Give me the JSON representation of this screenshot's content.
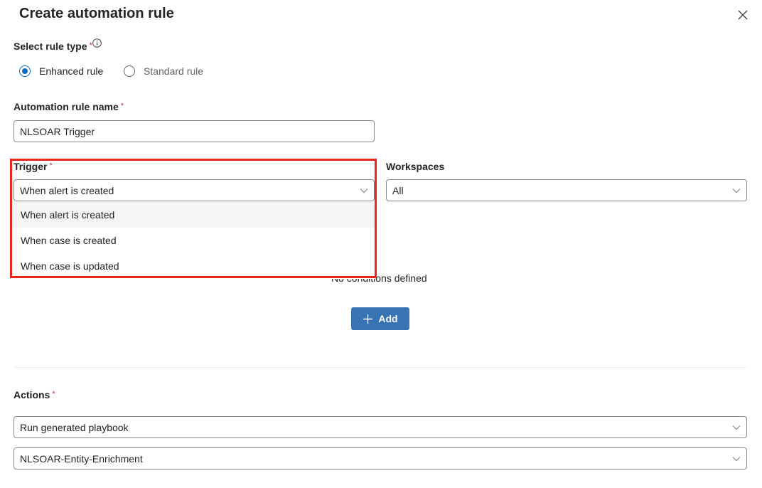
{
  "dialog": {
    "title": "Create automation rule",
    "close_icon": "close-icon"
  },
  "rule_type": {
    "label": "Select rule type",
    "required_mark": "*",
    "info_icon": "info-icon",
    "options": [
      {
        "label": "Enhanced rule",
        "selected": true
      },
      {
        "label": "Standard rule",
        "selected": false
      }
    ]
  },
  "rule_name": {
    "label": "Automation rule name",
    "required_mark": "*",
    "value": "NLSOAR Trigger"
  },
  "trigger": {
    "label": "Trigger",
    "required_mark": "*",
    "value": "When alert is created",
    "options": [
      "When alert is created",
      "When case is created",
      "When case is updated"
    ],
    "highlight_color": "#e8261a"
  },
  "workspaces": {
    "label": "Workspaces",
    "value": "All"
  },
  "conditions": {
    "empty_text": "No conditions defined",
    "add_label": "Add",
    "add_icon": "plus-icon"
  },
  "actions": {
    "label": "Actions",
    "required_mark": "*",
    "action_type": "Run generated playbook",
    "playbook": "NLSOAR-Entity-Enrichment"
  },
  "colors": {
    "accent": "#0f6cbd",
    "button": "#3873b6",
    "required": "#c4314b"
  }
}
